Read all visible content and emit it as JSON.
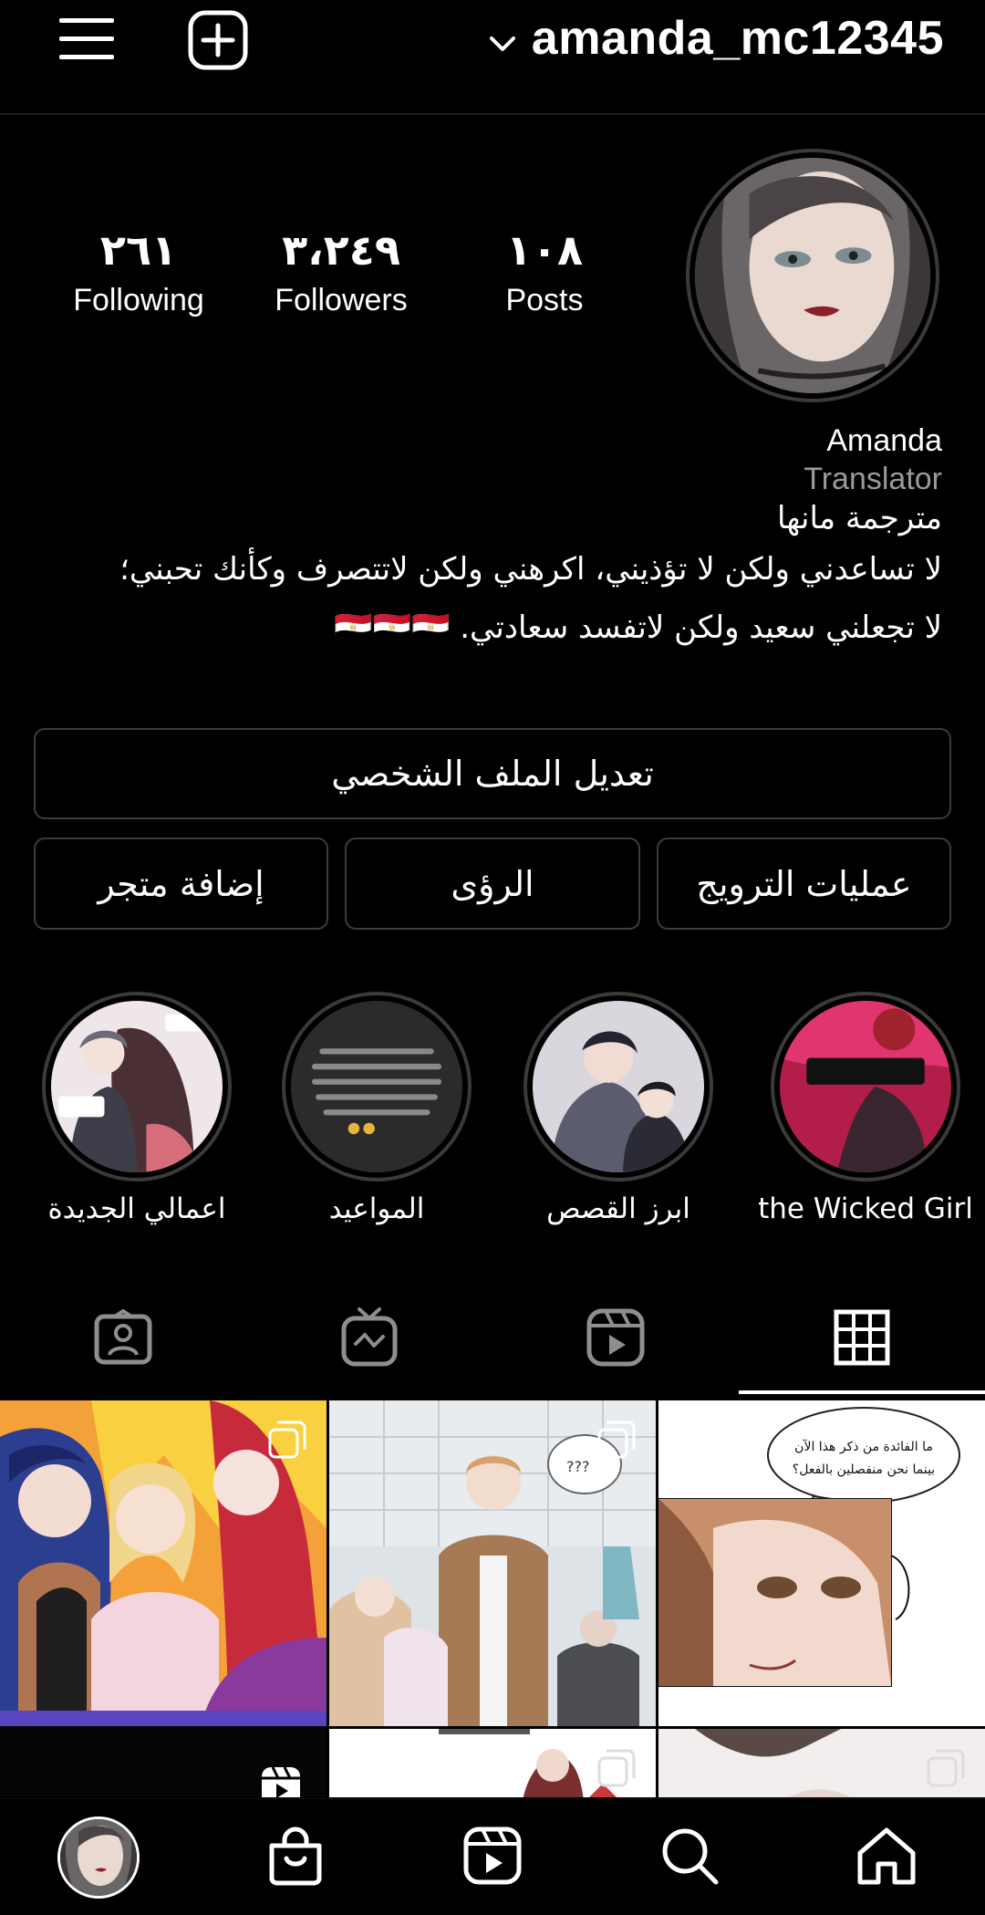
{
  "header": {
    "menu_icon": "hamburger-menu-icon",
    "create_icon": "plus-square-icon",
    "account_switch_icon": "chevron-down-icon",
    "username": "amanda_mc12345"
  },
  "profile": {
    "stats": {
      "posts": {
        "value": "١٠٨",
        "label": "Posts"
      },
      "followers": {
        "value": "٣،٢٤٩",
        "label": "Followers"
      },
      "following": {
        "value": "٢٦١",
        "label": "Following"
      }
    },
    "name": "Amanda",
    "category": "Translator",
    "bio_lines": [
      "مترجمة مانها",
      "لا تساعدني ولكن لا تؤذيني، اكرهني ولكن لاتتصرف وكأنك تحبني؛",
      "لا تجعلني سعيد ولكن لاتفسد سعادتي. 🇪🇬🇪🇬🇪🇬"
    ]
  },
  "buttons": {
    "edit_profile": "تعديل الملف الشخصي",
    "promotions": "عمليات الترويج",
    "insights": "الرؤى",
    "add_shop": "إضافة متجر"
  },
  "highlights": [
    {
      "label": "the Wicked Girl"
    },
    {
      "label": "ابرز القصص"
    },
    {
      "label": "المواعيد"
    },
    {
      "label": "اعمالي الجديدة"
    }
  ],
  "tabs": [
    {
      "icon": "grid-icon",
      "selected": true
    },
    {
      "icon": "reels-icon",
      "selected": false
    },
    {
      "icon": "igtv-icon",
      "selected": false
    },
    {
      "icon": "tagged-icon",
      "selected": false
    }
  ],
  "posts": {
    "speech_bubble_text": [
      "ما الفائدة من ذكر هذا الآن",
      "بينما نحن منفصلين بالفعل؟"
    ],
    "bubble_q": "???"
  },
  "bottom_nav": [
    "home-icon",
    "search-icon",
    "reels-icon",
    "shop-icon",
    "profile-avatar"
  ]
}
